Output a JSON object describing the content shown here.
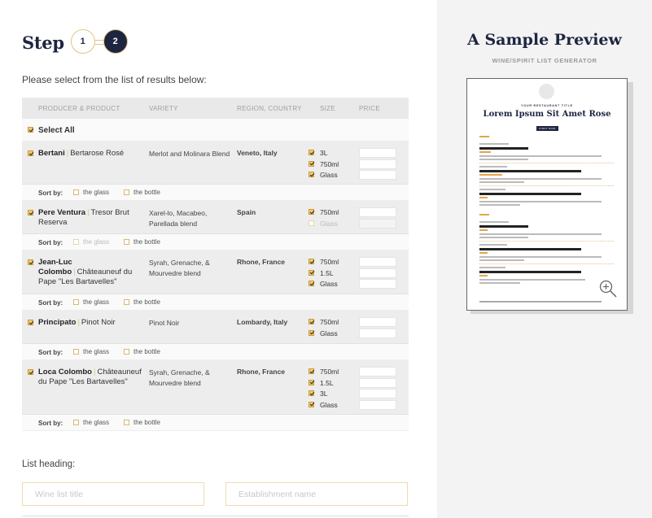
{
  "step": {
    "title": "Step",
    "steps": [
      "1",
      "2"
    ]
  },
  "prompt": "Please select from the list of results below:",
  "table": {
    "headers": [
      "PRODUCER & PRODUCT",
      "VARIETY",
      "REGION, COUNTRY",
      "SIZE",
      "PRICE"
    ],
    "select_all": "Select All",
    "sort_label": "Sort by:",
    "rows": [
      {
        "producer": "Bertani",
        "product": "Bertarose Rosé",
        "variety": "Merlot and Molinara Blend",
        "region": "Veneto,  Italy",
        "sizes": [
          {
            "label": "3L"
          },
          {
            "label": "750ml"
          },
          {
            "label": "Glass"
          }
        ],
        "sort": [
          "the glass",
          "the bottle"
        ]
      },
      {
        "producer": "Pere Ventura",
        "product": "Tresor Brut Reserva",
        "variety": "Xarel-lo, Macabeo, Parellada blend",
        "region": "Spain",
        "sizes": [
          {
            "label": "750ml"
          },
          {
            "label": "Glass"
          }
        ],
        "sort": [
          "the glass",
          "the bottle"
        ]
      },
      {
        "producer": "Jean-Luc Colombo",
        "product": "Châteauneuf du Pape \"Les Bartavelles\"",
        "variety": "Syrah, Grenache, & Mourvedre blend",
        "region": "Rhone, France",
        "sizes": [
          {
            "label": "750ml"
          },
          {
            "label": "1.5L"
          },
          {
            "label": "Glass"
          }
        ],
        "sort": [
          "the glass",
          "the bottle"
        ]
      },
      {
        "producer": "Principato",
        "product": "Pinot Noir",
        "variety": "Pinot Noir",
        "region": "Lombardy, Italy",
        "sizes": [
          {
            "label": "750ml"
          },
          {
            "label": "Glass"
          }
        ],
        "sort": [
          "the glass",
          "the bottle"
        ]
      },
      {
        "producer": "Loca Colombo",
        "product": "Châteauneuf du Pape \"Les Bartavelles\"",
        "variety": "Syrah, Grenache, & Mourvedre blend",
        "region": "Rhone, France",
        "sizes": [
          {
            "label": "750ml"
          },
          {
            "label": "1.5L"
          },
          {
            "label": "3L"
          },
          {
            "label": "Glass"
          }
        ],
        "sort": [
          "the glass",
          "the bottle"
        ]
      }
    ]
  },
  "list_heading": {
    "label": "List heading:",
    "wine_list_placeholder": "Wine list title",
    "establishment_placeholder": "Establishment name"
  },
  "preview": {
    "title": "A Sample Preview",
    "subtitle": "WINE/SPIRIT LIST GENERATOR",
    "kicker": "YOUR RESTAURANT TITLE",
    "heading": "Lorem Ipsum Sit Amet Rose",
    "pill": "PINOT NOIR"
  },
  "colors": {
    "navy": "#1d2540",
    "gold": "#e2c588",
    "panel": "#f3f3f3"
  }
}
